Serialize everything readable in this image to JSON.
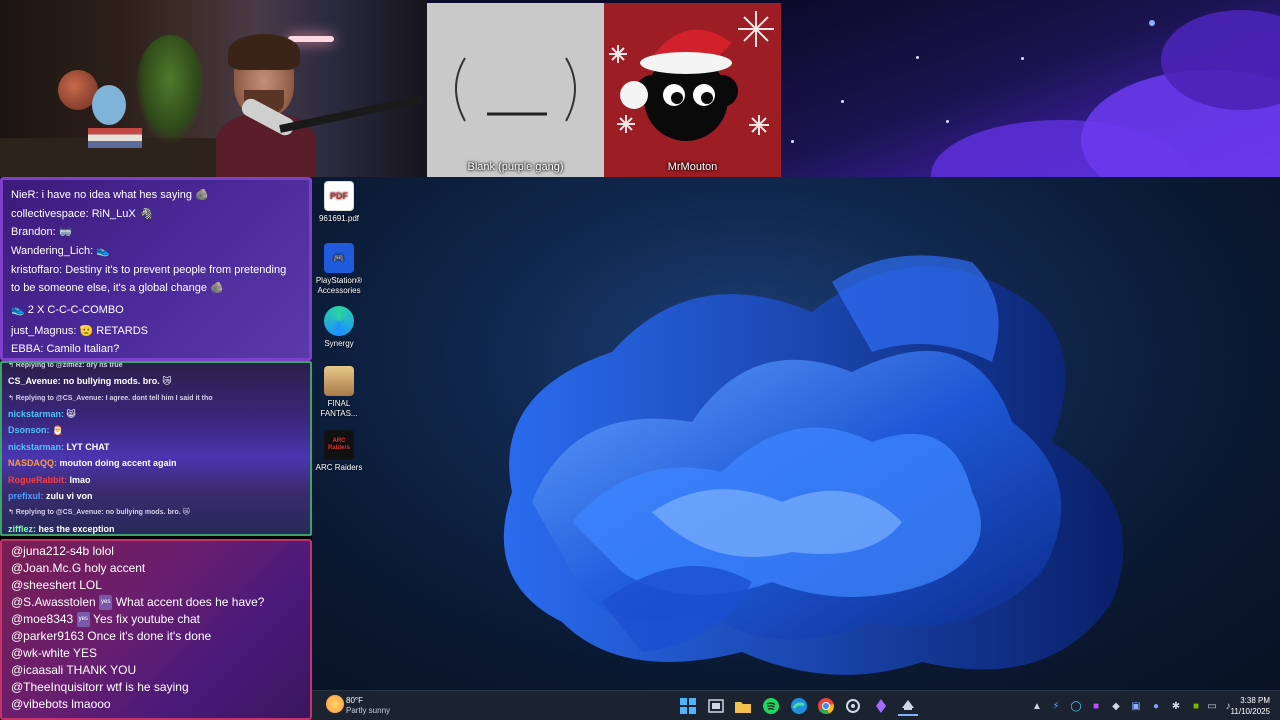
{
  "stream_cards": {
    "blank_label": "Blank (purple gang)",
    "mouton_label": "MrMouton"
  },
  "desktop_icons": [
    {
      "label": "961691.pdf",
      "glyph": "PDF"
    },
    {
      "label": "PlayStation® Accessories",
      "glyph": "🎮"
    },
    {
      "label": "Synergy",
      "glyph": ""
    },
    {
      "label": "FINAL FANTAS...",
      "glyph": ""
    },
    {
      "label": "ARC Raiders",
      "glyph": "ARC Raiders"
    }
  ],
  "chat_top": {
    "messages": [
      {
        "user": "NieR:",
        "text": "i have no idea what hes saying 🪨"
      },
      {
        "user": "collectivespace:",
        "text": "RiN_LuX 🦓"
      },
      {
        "user": "Brandon:",
        "text": "🥽"
      },
      {
        "user": "Wandering_Lich:",
        "text": "👟"
      },
      {
        "user": "kristoffaro:",
        "text": "Destiny it's to prevent people from pretending"
      },
      {
        "user": "",
        "text": "to be someone else, it's a global change 🪨"
      },
      {
        "user": "👟  2",
        "text": "X C-C-C-COMBO"
      },
      {
        "user": "just_Magnus:",
        "text": "🫡 RETARDS"
      },
      {
        "user": "EBBA:",
        "text": "Camilo Italian?"
      }
    ]
  },
  "chat_mid": {
    "rows": [
      {
        "kind": "reply",
        "text": "↰ Replying to @zifflez: dry its true"
      },
      {
        "kind": "msg",
        "user": "CS_Avenue:",
        "user_color": "#ffffff",
        "text": "no bullying mods. bro. 😿"
      },
      {
        "kind": "reply",
        "text": "↰ Replying to @CS_Avenue: I agree. dont tell him I said it tho"
      },
      {
        "kind": "msg",
        "user": "nickstarman:",
        "user_color": "#4fc3f7",
        "text": "😸"
      },
      {
        "kind": "msg",
        "user": "Dsonson:",
        "user_color": "#4fc3f7",
        "text": "🎅"
      },
      {
        "kind": "msg",
        "user": "nickstarman:",
        "user_color": "#4fc3f7",
        "text": "LYT CHAT"
      },
      {
        "kind": "msg",
        "user": "NASDAQQ:",
        "user_color": "#ff9a3c",
        "text": "mouton doing accent again"
      },
      {
        "kind": "msg",
        "user": "RogueRabbit:",
        "user_color": "#ff3b3b",
        "text": "lmao"
      },
      {
        "kind": "msg",
        "user": "prefixul:",
        "user_color": "#4f9cff",
        "text": "zulu vi von"
      },
      {
        "kind": "reply",
        "text": "↰ Replying to @CS_Avenue: no bullying mods. bro. 😿"
      },
      {
        "kind": "msg",
        "user": "zifflez:",
        "user_color": "#7fffb0",
        "text": "hes the exception"
      }
    ]
  },
  "chat_bottom": {
    "rows": [
      {
        "user": "@juna212-s4b",
        "text": "lolol"
      },
      {
        "user": "@Joan.Mc.G",
        "text": "holy accent"
      },
      {
        "user": "@sheeshert",
        "text": "LOL"
      },
      {
        "user": "@S.Awasstolen",
        "badge": "yes",
        "text": "What accent does he have?"
      },
      {
        "user": "@moe8343",
        "badge": "yes",
        "text": "Yes fix youtube chat"
      },
      {
        "user": "@parker9163",
        "text": "Once it's done it's done"
      },
      {
        "user": "@wk-white",
        "text": "YES"
      },
      {
        "user": "@icaasali",
        "text": "THANK YOU"
      },
      {
        "user": "@TheeInquisitorr",
        "text": "wtf is he saying"
      },
      {
        "user": "@vibebots",
        "text": "lmaooo"
      }
    ]
  },
  "taskbar": {
    "weather_temp": "80°F",
    "weather_cond": "Partly sunny",
    "time": "3:38 PM",
    "date": "11/10/2025",
    "apps": [
      "start-icon",
      "task-view-icon",
      "file-explorer-icon",
      "spotify-icon",
      "edge-icon",
      "chrome-icon",
      "settings-icon",
      "app-purple-icon",
      "steam-icon"
    ]
  }
}
